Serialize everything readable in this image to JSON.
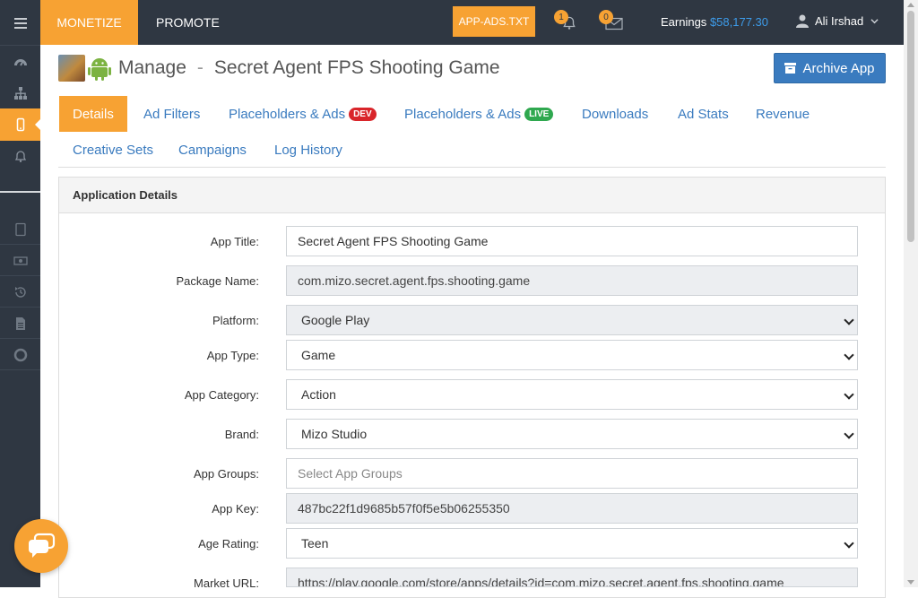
{
  "topbar": {
    "tabs": [
      {
        "label": "MONETIZE"
      },
      {
        "label": "PROMOTE"
      }
    ],
    "app_ads_label": "APP-ADS.TXT",
    "notifications_count": "1",
    "messages_count": "0",
    "earnings_label": "Earnings",
    "earnings_value": "$58,177.30",
    "user_name": "Ali Irshad"
  },
  "header": {
    "manage_label": "Manage",
    "separator": "-",
    "app_name": "Secret Agent FPS Shooting Game",
    "archive_label": "Archive App"
  },
  "tabs": [
    {
      "label": "Details"
    },
    {
      "label": "Ad Filters"
    },
    {
      "label": "Placeholders & Ads",
      "badge": "DEV"
    },
    {
      "label": "Placeholders & Ads",
      "badge": "LIVE"
    },
    {
      "label": "Downloads"
    },
    {
      "label": "Ad Stats"
    },
    {
      "label": "Revenue"
    },
    {
      "label": "Creative Sets"
    },
    {
      "label": "Campaigns"
    },
    {
      "label": "Log History"
    }
  ],
  "panel": {
    "title": "Application Details",
    "fields": [
      {
        "label": "App Title:",
        "value": "Secret Agent FPS Shooting Game"
      },
      {
        "label": "Package Name:",
        "value": "com.mizo.secret.agent.fps.shooting.game"
      },
      {
        "label": "Platform:",
        "value": "Google Play"
      },
      {
        "label": "App Type:",
        "value": "Game"
      },
      {
        "label": "App Category:",
        "value": "Action"
      },
      {
        "label": "Brand:",
        "value": "Mizo Studio"
      },
      {
        "label": "App Groups:",
        "placeholder": "Select App Groups"
      },
      {
        "label": "App Key:",
        "value": "487bc22f1d9685b57f0f5e5b06255350"
      },
      {
        "label": "Age Rating:",
        "value": "Teen"
      },
      {
        "label": "Market URL:",
        "value": "https://play.google.com/store/apps/details?id=com.mizo.secret.agent.fps.shooting.game"
      }
    ]
  },
  "colors": {
    "accent": "#f7a233",
    "dark": "#2f3742",
    "link": "#3a7bbf",
    "dev_badge": "#d9252a",
    "live_badge": "#2fa84f"
  },
  "icons": [
    "menu-icon",
    "dashboard-icon",
    "sitemap-icon",
    "mobile-icon",
    "bell-icon",
    "tablet-icon",
    "money-icon",
    "history-icon",
    "document-icon",
    "lifebuoy-icon",
    "envelope-icon",
    "user-icon",
    "chevron-down-icon",
    "archive-icon",
    "android-icon",
    "chat-icon"
  ]
}
